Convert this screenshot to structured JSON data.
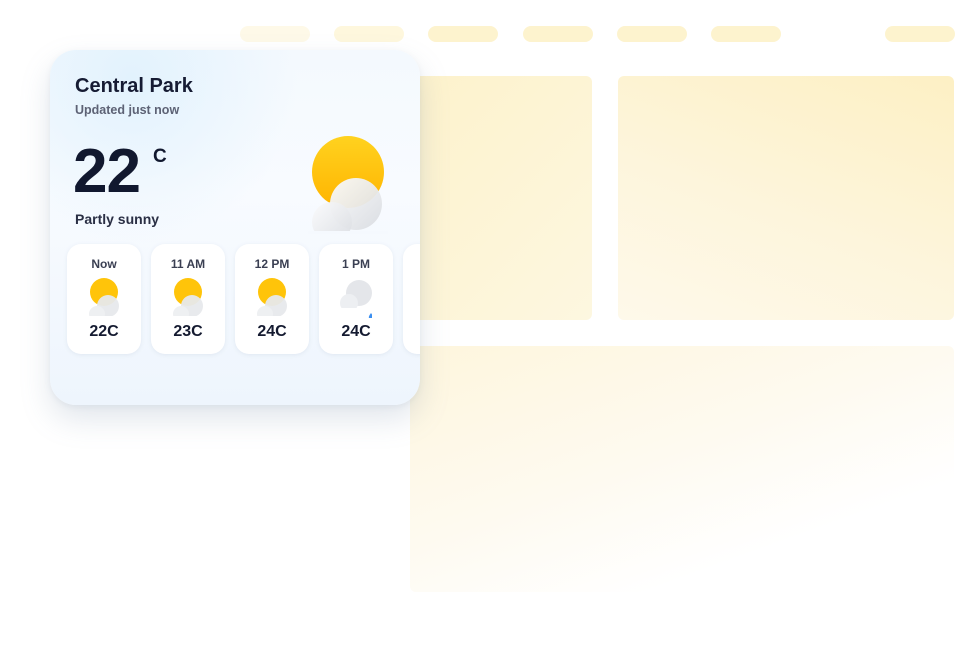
{
  "card": {
    "location": "Central Park",
    "updated": "Updated just now",
    "temperature": "22",
    "unit": "C",
    "condition": "Partly sunny",
    "icon": "partly-sunny-icon"
  },
  "hourly": [
    {
      "label": "Now",
      "temp": "22C",
      "icon": "partly-sunny-icon"
    },
    {
      "label": "11 AM",
      "temp": "23C",
      "icon": "partly-sunny-icon"
    },
    {
      "label": "12 PM",
      "temp": "24C",
      "icon": "partly-sunny-icon"
    },
    {
      "label": "1 PM",
      "temp": "24C",
      "icon": "cloud-rain-icon"
    }
  ],
  "colors": {
    "sun": "#ffc40a",
    "cloud": "#e4e6ea",
    "rain": "#3b8ff0",
    "background_accent": "#fdf1c6"
  }
}
